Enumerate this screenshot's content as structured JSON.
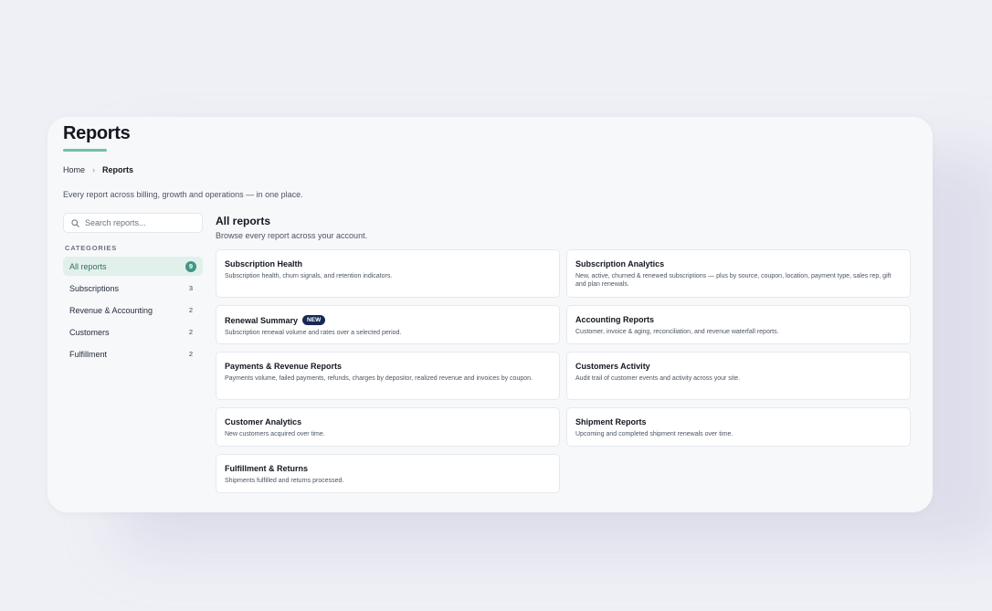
{
  "page": {
    "title": "Reports",
    "subtitle": "Every report across billing, growth and operations — in one place."
  },
  "breadcrumb": {
    "home": "Home",
    "separator": "›",
    "current": "Reports"
  },
  "sidebar": {
    "search_placeholder": "Search reports...",
    "categories_heading": "CATEGORIES",
    "categories": [
      {
        "label": "All reports",
        "count": "9",
        "active": true
      },
      {
        "label": "Subscriptions",
        "count": "3"
      },
      {
        "label": "Revenue & Accounting",
        "count": "2"
      },
      {
        "label": "Customers",
        "count": "2"
      },
      {
        "label": "Fulfillment",
        "count": "2"
      }
    ]
  },
  "main": {
    "title": "All reports",
    "subtitle": "Browse every report across your account.",
    "new_badge": "NEW",
    "reports": [
      {
        "title": "Subscription Health",
        "desc": "Subscription health, churn signals, and retention indicators."
      },
      {
        "title": "Subscription Analytics",
        "desc": "New, active, churned & renewed subscriptions — plus by source, coupon, location, payment type, sales rep, gift and plan renewals."
      },
      {
        "title": "Renewal Summary",
        "desc": "Subscription renewal volume and rates over a selected period."
      },
      {
        "title": "Accounting Reports",
        "desc": "Customer, invoice & aging, reconciliation, and revenue waterfall reports."
      },
      {
        "title": "Payments & Revenue Reports",
        "desc": "Payments volume, failed payments, refunds, charges by depositor, realized revenue and invoices by coupon."
      },
      {
        "title": "Customers Activity",
        "desc": "Audit trail of customer events and activity across your site."
      },
      {
        "title": "Customer Analytics",
        "desc": "New customers acquired over time."
      },
      {
        "title": "Shipment Reports",
        "desc": "Upcoming and completed shipment renewals over time."
      },
      {
        "title": "Fulfillment & Returns",
        "desc": "Shipments fulfilled and returns processed."
      }
    ]
  },
  "colors": {
    "accent": "#3f9784",
    "accent_light": "#e2f0ec",
    "badge_new": "#172a53",
    "background": "#efeff6"
  },
  "icons": {
    "search": "search-icon",
    "breadcrumb_separator": "chevron-right-icon"
  }
}
